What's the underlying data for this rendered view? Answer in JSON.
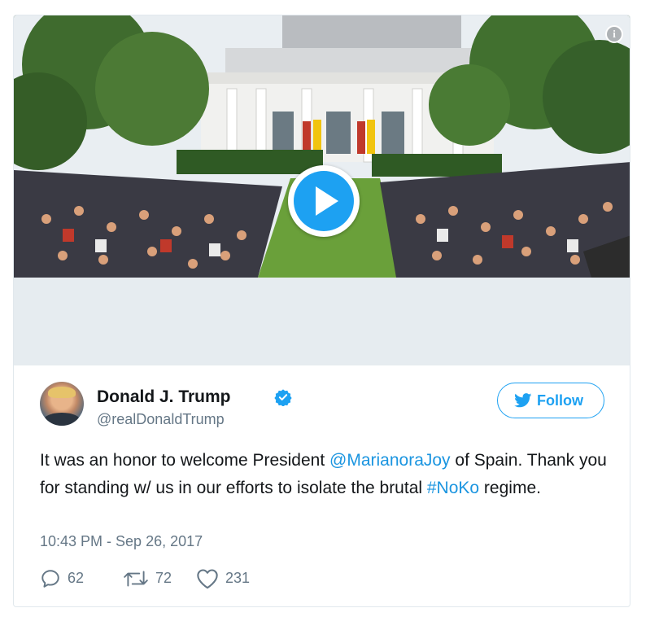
{
  "media": {
    "info_icon": "info-icon",
    "play_icon": "play-icon"
  },
  "author": {
    "name": "Donald J. Trump",
    "handle": "@realDonaldTrump",
    "verified_icon": "verified-badge-icon"
  },
  "follow": {
    "label": "Follow",
    "icon": "twitter-bird-icon"
  },
  "tweet": {
    "text_1": "It was an honor to welcome President ",
    "mention": "@MarianoraJoy",
    "text_2": " of Spain. Thank you for standing w/ us in our efforts to isolate the brutal ",
    "hashtag": "#NoKo",
    "text_3": " regime."
  },
  "timestamp": "10:43 PM - Sep 26, 2017",
  "actions": {
    "replies": "62",
    "retweets": "72",
    "likes": "231"
  },
  "colors": {
    "accent": "#1da1f2",
    "link": "#1b95e0",
    "secondary_text": "#657786",
    "primary_text": "#14171a",
    "border": "#e1e8ed"
  }
}
